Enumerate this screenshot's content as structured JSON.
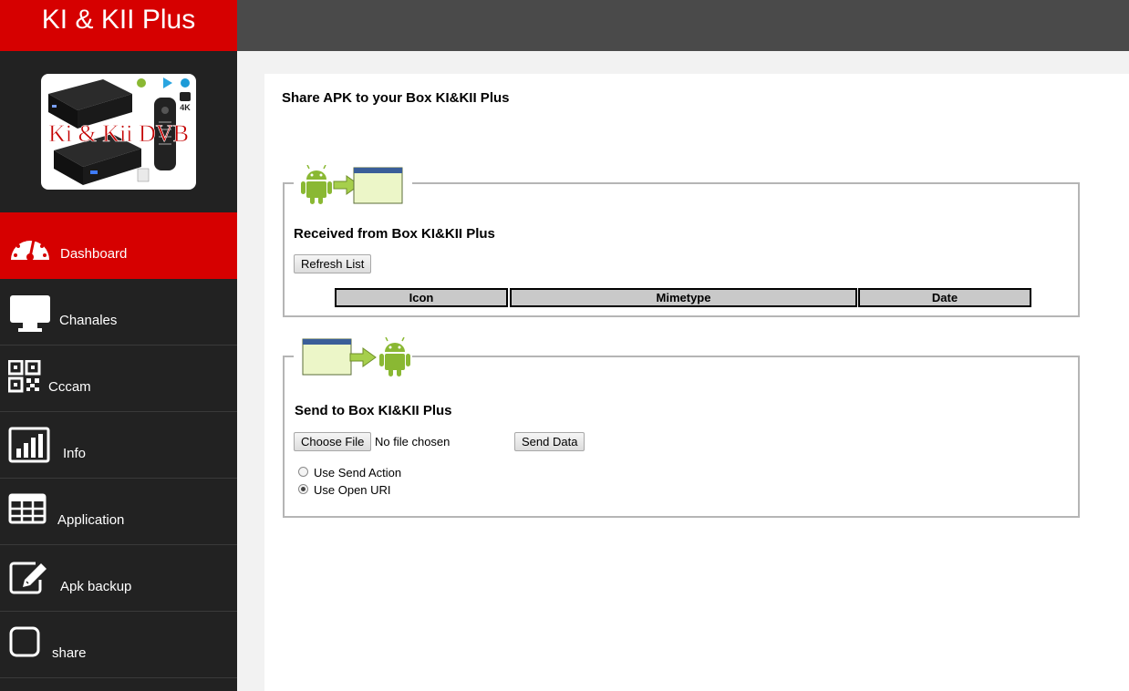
{
  "app": {
    "title": "KI & KII Plus"
  },
  "logo": {
    "text": "Ki & Kii DVB",
    "badge": "4K"
  },
  "nav": [
    {
      "label": "Dashboard",
      "icon": "speedometer-icon",
      "active": true
    },
    {
      "label": "Chanales",
      "icon": "monitor-icon"
    },
    {
      "label": "Cccam",
      "icon": "qr-code-icon"
    },
    {
      "label": "Info",
      "icon": "bar-chart-icon"
    },
    {
      "label": "Application",
      "icon": "grid-table-icon"
    },
    {
      "label": "Apk backup",
      "icon": "edit-icon"
    },
    {
      "label": "share",
      "icon": "checkbox-icon"
    }
  ],
  "main": {
    "title": "Share APK to your Box KI&KII Plus",
    "received": {
      "heading": "Received from Box KI&KII Plus",
      "refresh_label": "Refresh List",
      "columns": [
        "Icon",
        "Mimetype",
        "Date"
      ]
    },
    "send": {
      "heading": "Send to Box KI&KII Plus",
      "choose_label": "Choose File",
      "file_status": "No file chosen",
      "send_label": "Send Data",
      "options": [
        {
          "label": "Use Send Action",
          "checked": false
        },
        {
          "label": "Use Open URI",
          "checked": true
        }
      ]
    }
  },
  "colors": {
    "accent": "#d60000",
    "sidebar": "#222222",
    "topbar": "#4a4a4a",
    "android": "#8ab833"
  }
}
